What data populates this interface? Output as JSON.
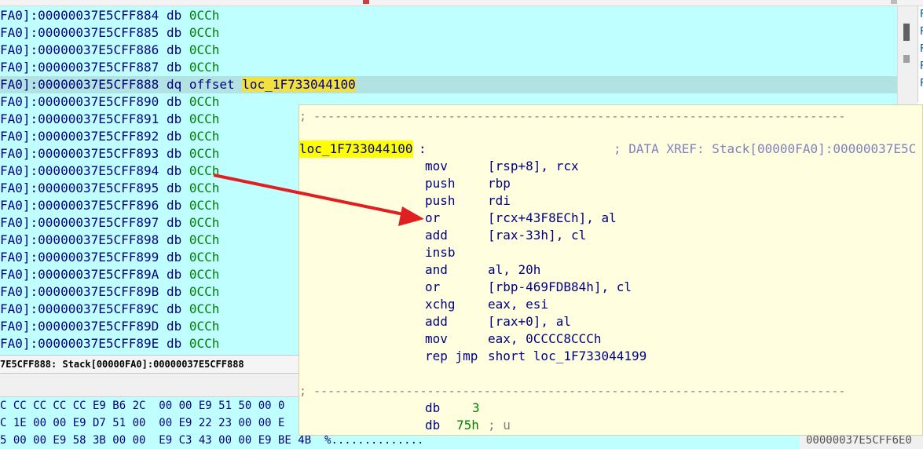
{
  "window": {
    "title_fragment": ""
  },
  "listing": {
    "rows": [
      {
        "seg": "FA0]:00000037E5CFF884",
        "mnem": "db",
        "oper": "0CCh"
      },
      {
        "seg": "FA0]:00000037E5CFF885",
        "mnem": "db",
        "oper": "0CCh"
      },
      {
        "seg": "FA0]:00000037E5CFF886",
        "mnem": "db",
        "oper": "0CCh"
      },
      {
        "seg": "FA0]:00000037E5CFF887",
        "mnem": "db",
        "oper": "0CCh"
      },
      {
        "seg": "FA0]:00000037E5CFF888",
        "mnem": "dq",
        "oper": "offset",
        "label": "loc_1F733044100"
      },
      {
        "seg": "FA0]:00000037E5CFF890",
        "mnem": "db",
        "oper": "0CCh"
      },
      {
        "seg": "FA0]:00000037E5CFF891",
        "mnem": "db",
        "oper": "0CCh"
      },
      {
        "seg": "FA0]:00000037E5CFF892",
        "mnem": "db",
        "oper": "0CCh"
      },
      {
        "seg": "FA0]:00000037E5CFF893",
        "mnem": "db",
        "oper": "0CCh"
      },
      {
        "seg": "FA0]:00000037E5CFF894",
        "mnem": "db",
        "oper": "0CCh"
      },
      {
        "seg": "FA0]:00000037E5CFF895",
        "mnem": "db",
        "oper": "0CCh"
      },
      {
        "seg": "FA0]:00000037E5CFF896",
        "mnem": "db",
        "oper": "0CCh"
      },
      {
        "seg": "FA0]:00000037E5CFF897",
        "mnem": "db",
        "oper": "0CCh"
      },
      {
        "seg": "FA0]:00000037E5CFF898",
        "mnem": "db",
        "oper": "0CCh"
      },
      {
        "seg": "FA0]:00000037E5CFF899",
        "mnem": "db",
        "oper": "0CCh"
      },
      {
        "seg": "FA0]:00000037E5CFF89A",
        "mnem": "db",
        "oper": "0CCh"
      },
      {
        "seg": "FA0]:00000037E5CFF89B",
        "mnem": "db",
        "oper": "0CCh"
      },
      {
        "seg": "FA0]:00000037E5CFF89C",
        "mnem": "db",
        "oper": "0CCh"
      },
      {
        "seg": "FA0]:00000037E5CFF89D",
        "mnem": "db",
        "oper": "0CCh"
      },
      {
        "seg": "FA0]:00000037E5CFF89E",
        "mnem": "db",
        "oper": "0CCh"
      }
    ]
  },
  "status_line": "7E5CFF888: Stack[00000FA0]:00000037E5CFF888",
  "hex": {
    "rows": [
      {
        "bytes": "C CC CC CC CC E9 B6 2C  00 00 E9 51 50 00 0",
        "ascii": ""
      },
      {
        "bytes": "C 1E 00 00 E9 D7 51 00  00 E9 22 23 00 00 E",
        "ascii": ""
      },
      {
        "bytes": "5 00 00 E9 58 3B 00 00  E9 C3 43 00 00 E9 BE 4B",
        "ascii": "%.............."
      }
    ],
    "right_address": "00000037E5CFF6E0"
  },
  "right_panel": {
    "items": [
      "F",
      "F",
      "F",
      "F",
      "F"
    ]
  },
  "popup": {
    "separator": "; ---------------------------------------------------------------------------",
    "label": "loc_1F733044100",
    "label_colon": ":",
    "xref": "; DATA XREF: Stack[00000FA0]:00000037E5C",
    "instructions": [
      {
        "mnem": "mov",
        "ops": "[rsp+8], rcx"
      },
      {
        "mnem": "push",
        "ops": "rbp"
      },
      {
        "mnem": "push",
        "ops": "rdi"
      },
      {
        "mnem": "or",
        "ops": "[rcx+43F8ECh], al"
      },
      {
        "mnem": "add",
        "ops": "[rax-33h], cl"
      },
      {
        "mnem": "insb",
        "ops": ""
      },
      {
        "mnem": "and",
        "ops": "al, 20h"
      },
      {
        "mnem": "or",
        "ops": "[rbp-469FDB84h], cl"
      },
      {
        "mnem": "xchg",
        "ops": "eax, esi"
      },
      {
        "mnem": "add",
        "ops": "[rax+0], al"
      },
      {
        "mnem": "mov",
        "ops": "eax, 0CCCC8CCCh"
      },
      {
        "mnem": "rep jmp",
        "ops": "short loc_1F733044199"
      }
    ],
    "tail": [
      {
        "mnem": "db",
        "ops": "3",
        "comment": ""
      },
      {
        "mnem": "db",
        "ops": "75h",
        "comment": "; u"
      }
    ]
  },
  "colors": {
    "listing_bg": "#c0ffff",
    "popup_bg": "#ffffe0",
    "label_highlight": "#ffff00",
    "arrow": "#e02020"
  }
}
